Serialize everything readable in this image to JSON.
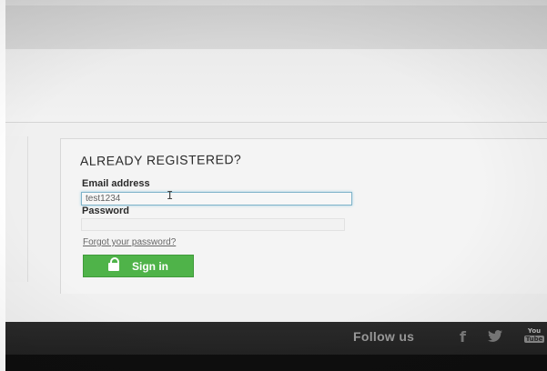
{
  "login": {
    "title": "ALREADY REGISTERED?",
    "email_label": "Email address",
    "email_value": "test1234",
    "password_label": "Password",
    "forgot_password": "Forgot your password?",
    "signin_label": "Sign in"
  },
  "footer": {
    "follow_us": "Follow us",
    "facebook_glyph": "f",
    "twitter_glyph": "🐦",
    "youtube_top": "You",
    "youtube_bottom": "Tube"
  },
  "colors": {
    "signin_green": "#4fb349",
    "footer_bg": "#2a2a2a",
    "input_focus": "#7fb3c9"
  }
}
